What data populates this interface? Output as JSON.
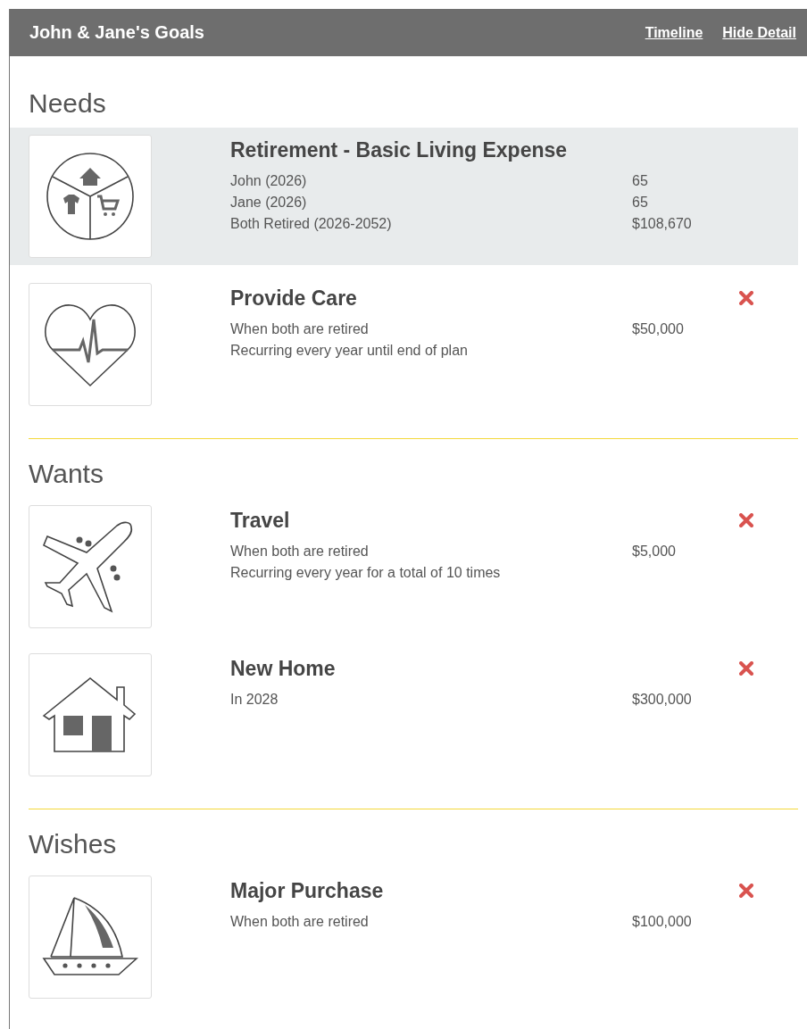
{
  "header": {
    "title": "John & Jane's Goals",
    "links": [
      "Timeline",
      "Hide Detail"
    ]
  },
  "sections": [
    {
      "title": "Needs",
      "goals": [
        {
          "kind": "pie",
          "title": "Retirement - Basic Living Expense",
          "selected": true,
          "deletable": false,
          "details": [
            {
              "text": "John (2026)",
              "value": "65"
            },
            {
              "text": "Jane (2026)",
              "value": "65"
            },
            {
              "text": "Both Retired (2026-2052)",
              "value": "$108,670"
            }
          ]
        },
        {
          "kind": "heart",
          "title": "Provide Care",
          "selected": false,
          "deletable": true,
          "details": [
            {
              "text": "When both are retired",
              "value": "$50,000"
            },
            {
              "text": "Recurring every year until end of plan"
            }
          ]
        }
      ]
    },
    {
      "title": "Wants",
      "goals": [
        {
          "kind": "plane",
          "title": "Travel",
          "selected": false,
          "deletable": true,
          "details": [
            {
              "text": "When both are retired",
              "value": "$5,000"
            },
            {
              "text": "Recurring every year for a total of 10 times"
            }
          ]
        },
        {
          "kind": "house",
          "title": "New Home",
          "selected": false,
          "deletable": true,
          "details": [
            {
              "text": "In 2028",
              "value": "$300,000"
            }
          ]
        }
      ]
    },
    {
      "title": "Wishes",
      "goals": [
        {
          "kind": "boat",
          "title": "Major Purchase",
          "selected": false,
          "deletable": true,
          "details": [
            {
              "text": "When both are retired",
              "value": "$100,000"
            }
          ]
        }
      ]
    }
  ]
}
